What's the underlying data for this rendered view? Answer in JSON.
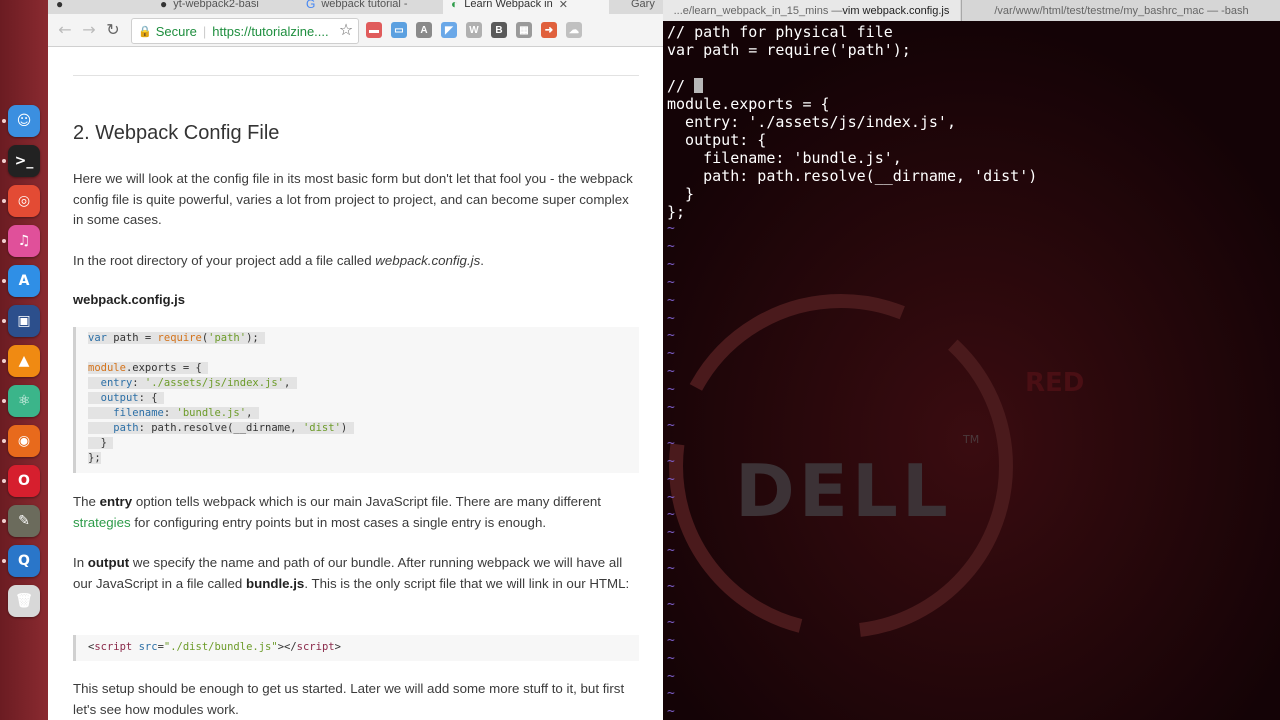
{
  "dock": {
    "apps": [
      {
        "name": "finder",
        "glyph": "☺",
        "bg": "#3b8fe0"
      },
      {
        "name": "terminal",
        "glyph": ">_",
        "bg": "#222222"
      },
      {
        "name": "chrome",
        "glyph": "◎",
        "bg": "#e34b34"
      },
      {
        "name": "itunes",
        "glyph": "♫",
        "bg": "#e0509a"
      },
      {
        "name": "app-store",
        "glyph": "A",
        "bg": "#2f8fe6"
      },
      {
        "name": "virtualbox",
        "glyph": "▣",
        "bg": "#2c4f8c"
      },
      {
        "name": "vlc",
        "glyph": "▲",
        "bg": "#f08a12"
      },
      {
        "name": "atom",
        "glyph": "⚛",
        "bg": "#3bb58a"
      },
      {
        "name": "firefox",
        "glyph": "◉",
        "bg": "#e86a1c"
      },
      {
        "name": "opera",
        "glyph": "O",
        "bg": "#d61f2e"
      },
      {
        "name": "gimp",
        "glyph": "✎",
        "bg": "#6b6b5c"
      },
      {
        "name": "quicktime",
        "glyph": "Q",
        "bg": "#2a76c9"
      },
      {
        "name": "trash",
        "glyph": "🗑",
        "bg": "#d8d8d8"
      }
    ]
  },
  "browser": {
    "tabs": [
      {
        "title": "yt-webpack2-basi",
        "icon": "github"
      },
      {
        "title": "webpack tutorial -",
        "icon": "google"
      },
      {
        "title": "Learn Webpack in",
        "icon": "tz"
      },
      {
        "title": "Gary",
        "icon": "none"
      }
    ],
    "address": {
      "secure_label": "Secure",
      "url": "https://tutorialzine...."
    },
    "extensions": [
      {
        "name": "ext-red",
        "label": "▬",
        "color": "#e05c5c"
      },
      {
        "name": "ext-blue",
        "label": "▭",
        "color": "#5ba0e0"
      },
      {
        "name": "ext-gray-a",
        "label": "A",
        "color": "#8a8a8a"
      },
      {
        "name": "ext-triangle",
        "label": "◤",
        "color": "#6aa8e8"
      },
      {
        "name": "ext-w",
        "label": "W",
        "color": "#b0b0b0"
      },
      {
        "name": "ext-b",
        "label": "B",
        "color": "#5a5a5a"
      },
      {
        "name": "ext-grid",
        "label": "▦",
        "color": "#9a9a9a"
      },
      {
        "name": "ext-arrow",
        "label": "➜",
        "color": "#e0603c"
      },
      {
        "name": "ext-cloud",
        "label": "☁",
        "color": "#c0c0c0"
      }
    ]
  },
  "article": {
    "heading": "2. Webpack Config File",
    "p1": "Here we will look at the config file in its most basic form but don't let that fool you - the webpack config file is quite powerful, varies a lot from project to project, and can become super complex in some cases.",
    "p2_prefix": "In the root directory of your project add a file called ",
    "p2_file": "webpack.config.js",
    "p2_suffix": ".",
    "file_label": "webpack.config.js",
    "p3_a": "The ",
    "p3_b": "entry",
    "p3_c": " option tells webpack which is our main JavaScript file. There are many different ",
    "p3_link": "strategies",
    "p3_d": " for configuring entry points but in most cases a single entry is enough.",
    "p4_a": "In ",
    "p4_b": "output",
    "p4_c": " we specify the name and path of our bundle. After running webpack we will have all our JavaScript in a file called ",
    "p4_d": "bundle.js",
    "p4_e": ". This is the only script file that we will link in our HTML:",
    "p5": "This setup should be enough to get us started. Later we will add some more stuff to it, but first let's see how modules work."
  },
  "code": {
    "l1": {
      "kw": "var",
      "a": " path = ",
      "fn": "require",
      "b": "(",
      "str": "'path'",
      "c": ");"
    },
    "l3": {
      "fn": "module",
      "a": ".exports = {"
    },
    "l4": {
      "kw": "entry",
      "a": ": ",
      "str": "'./assets/js/index.js'",
      "b": ","
    },
    "l5": {
      "kw": "output",
      "a": ": {"
    },
    "l6": {
      "kw": "filename",
      "a": ": ",
      "str": "'bundle.js'",
      "b": ","
    },
    "l7": {
      "kw": "path",
      "a": ": path.resolve(__dirname, ",
      "str": "'dist'",
      "b": ")"
    },
    "l8": "}",
    "l9": "};",
    "html": {
      "a": "<",
      "tag": "script",
      "attr": " src",
      "b": "=",
      "str": "\"./dist/bundle.js\"",
      "c": "></",
      "tag2": "script",
      "d": ">"
    }
  },
  "terminal": {
    "tabs": [
      {
        "dim": "...e/learn_webpack_in_15_mins — ",
        "main": "vim webpack.config.js"
      },
      {
        "dim": "/var/www/html/test/testme/my_bashrc_mac — -bash",
        "main": ""
      }
    ],
    "lines": [
      "// path for physical file",
      "var path = require('path');",
      "",
      "// ",
      "module.exports = {",
      "  entry: './assets/js/index.js',",
      "  output: {",
      "    filename: 'bundle.js',",
      "    path: path.resolve(__dirname, 'dist')",
      "  }",
      "};"
    ],
    "tilde": "~",
    "tilde_count": 28,
    "wallpaper": {
      "brand": "DELL",
      "tm": "TM",
      "word": "RED"
    }
  }
}
